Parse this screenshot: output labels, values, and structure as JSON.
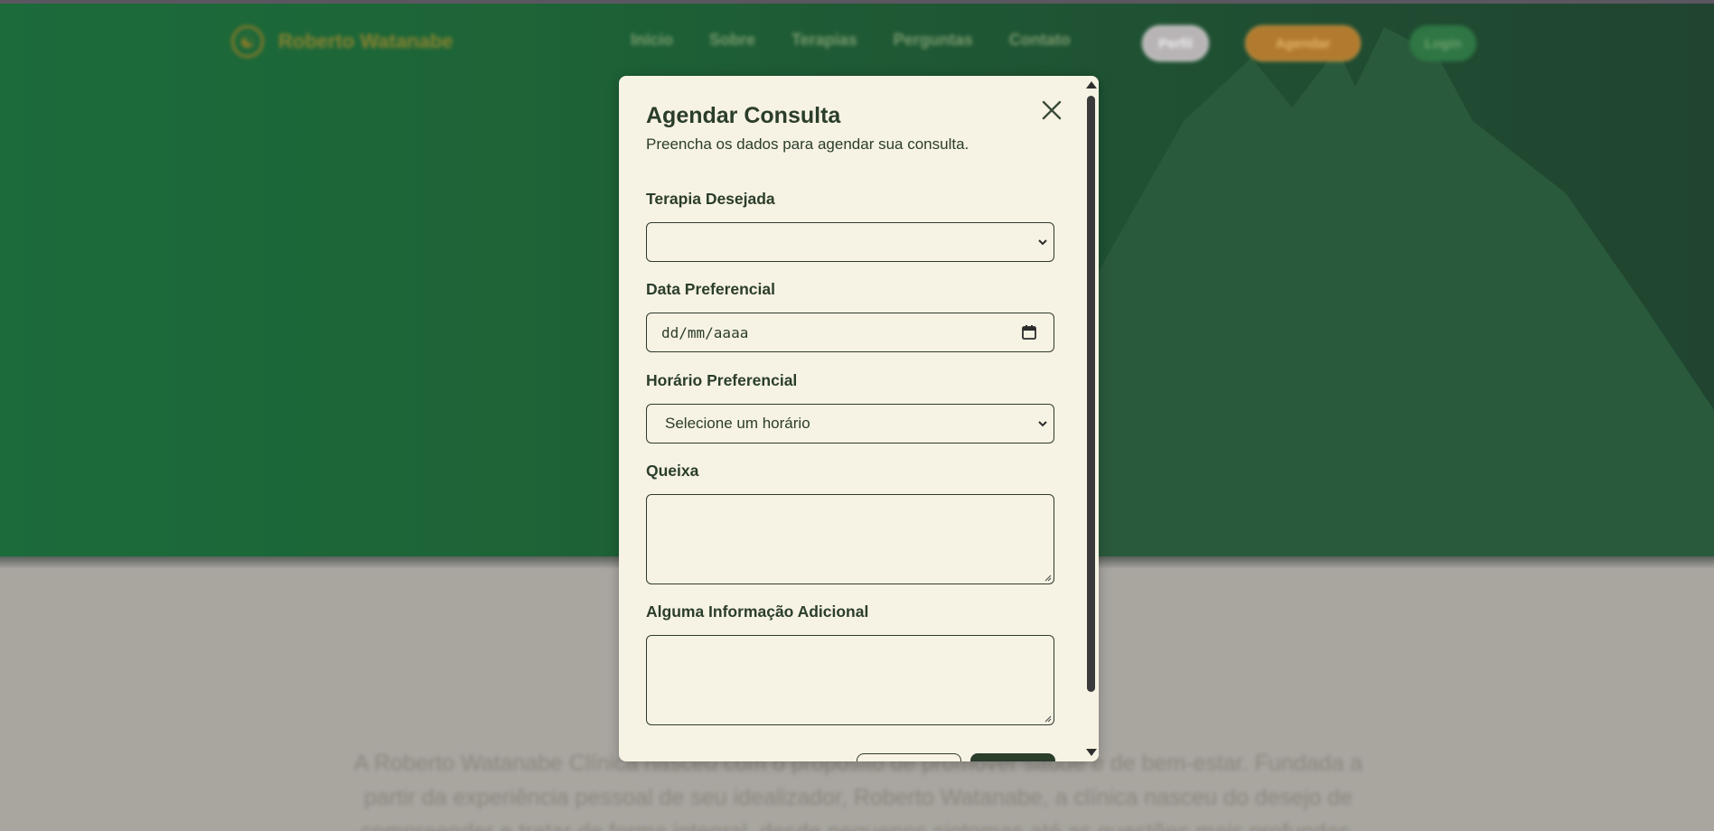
{
  "background_page": {
    "brand_name": "Roberto Watanabe",
    "nav": [
      "Início",
      "Sobre",
      "Terapias",
      "Perguntas",
      "Contato"
    ],
    "pill_a": "Perfil",
    "pill_b": "Agendar",
    "pill_c": "Login",
    "lower_text": "A Roberto Watanabe Clínica nasceu com o propósito de promover saúde e de bem-estar. Fundada a partir da experiência pessoal de seu idealizador, Roberto Watanabe, a clínica nasceu do desejo de compreender e tratar de forma integral, desde pequenos sintomas até as questões mais profundas."
  },
  "modal": {
    "title": "Agendar Consulta",
    "subtitle": "Preencha os dados para agendar sua consulta.",
    "fields": {
      "terapia": {
        "label": "Terapia Desejada",
        "value": ""
      },
      "data": {
        "label": "Data Preferencial",
        "placeholder": "dd/mm/aaaa"
      },
      "horario": {
        "label": "Horário Preferencial",
        "value": "Selecione um horário"
      },
      "queixa": {
        "label": "Queixa",
        "value": ""
      },
      "info": {
        "label": "Alguma Informação Adicional",
        "value": ""
      }
    }
  },
  "colors": {
    "modal_bg": "#f7f3e4",
    "text": "#2b3d2b",
    "hero_green": "#1d6437",
    "dark_green": "#2b3d2b"
  }
}
